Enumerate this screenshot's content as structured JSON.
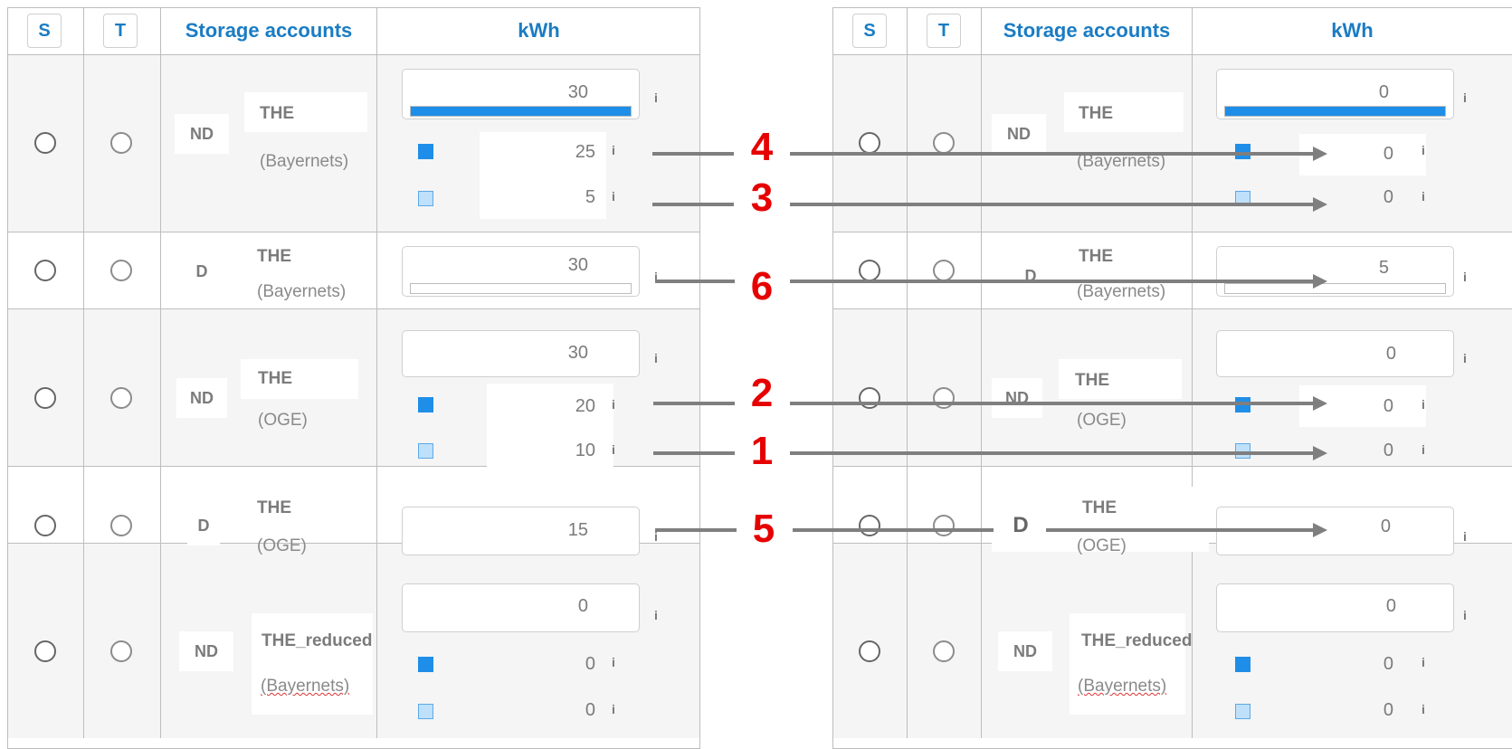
{
  "colors": {
    "header_text": "#1a7cc4",
    "bar_fill": "#1f8ee8",
    "swatch_light": "#bfe0fa",
    "arrow": "#7f7f7f",
    "step_label": "#e60000",
    "border": "#bdbdbd"
  },
  "tables": [
    {
      "header": {
        "s": "S",
        "t": "T",
        "accounts": "Storage accounts",
        "kwh": "kWh"
      },
      "rows": [
        {
          "tag": "ND",
          "name": "THE",
          "sub": "(Bayernets)",
          "total": "30",
          "bar_fill_fraction": 1.0,
          "dark": "25",
          "light": "5"
        },
        {
          "tag": "D",
          "name": "THE",
          "sub": "(Bayernets)",
          "total": "30",
          "bar_fill_fraction": 0.0
        },
        {
          "tag": "ND",
          "name": "THE",
          "sub": "(OGE)",
          "total": "30",
          "dark": "20",
          "light": "10"
        },
        {
          "tag": "D",
          "name": "THE",
          "sub": "(OGE)",
          "total": "15"
        },
        {
          "tag": "ND",
          "name": "THE_reduced",
          "sub": "(Bayernets)",
          "total": "0",
          "dark": "0",
          "light": "0"
        }
      ],
      "info": "i"
    },
    {
      "header": {
        "s": "S",
        "t": "T",
        "accounts": "Storage accounts",
        "kwh": "kWh"
      },
      "rows": [
        {
          "tag": "ND",
          "name": "THE",
          "sub": "(Bayernets)",
          "total": "0",
          "bar_fill_fraction": 1.0,
          "dark": "0",
          "light": "0"
        },
        {
          "tag": "D",
          "name": "THE",
          "sub": "(Bayernets)",
          "total": "5",
          "bar_fill_fraction": 0.0
        },
        {
          "tag": "ND",
          "name": "THE",
          "sub": "(OGE)",
          "total": "0",
          "dark": "0",
          "light": "0"
        },
        {
          "tag": "D",
          "name": "THE",
          "sub": "(OGE)",
          "total": "0"
        },
        {
          "tag": "ND",
          "name": "THE_reduced",
          "sub": "(Bayernets)",
          "total": "0",
          "dark": "0",
          "light": "0"
        }
      ],
      "info": "i"
    }
  ],
  "steps": [
    "4",
    "3",
    "6",
    "2",
    "1",
    "5"
  ]
}
